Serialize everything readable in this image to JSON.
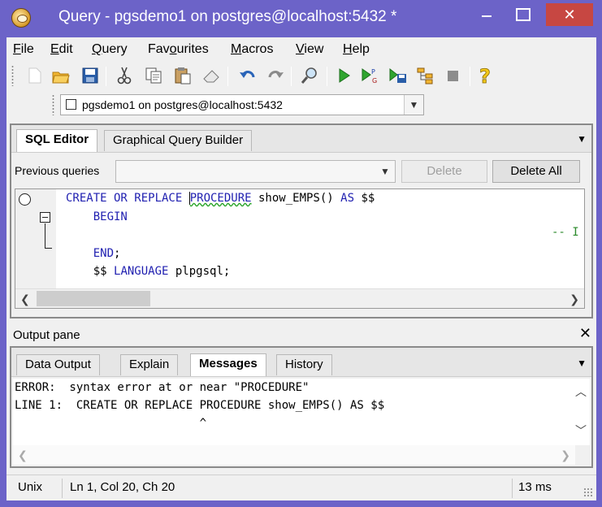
{
  "window": {
    "title": "Query - pgsdemo1 on postgres@localhost:5432 *",
    "minimize_glyph": "",
    "maximize_glyph": "",
    "close_glyph": "✕"
  },
  "menu": [
    {
      "label": "File",
      "mnemonic": "F",
      "rest": "ile"
    },
    {
      "label": "Edit",
      "mnemonic": "E",
      "rest": "dit"
    },
    {
      "label": "Query",
      "mnemonic": "Q",
      "rest": "uery"
    },
    {
      "label": "Favourites",
      "pre": "Fav",
      "mnemonic": "o",
      "rest": "urites"
    },
    {
      "label": "Macros",
      "mnemonic": "M",
      "rest": "acros"
    },
    {
      "label": "View",
      "mnemonic": "V",
      "rest": "iew"
    },
    {
      "label": "Help",
      "mnemonic": "H",
      "rest": "elp"
    }
  ],
  "toolbar": {
    "icons": [
      "new-file-icon",
      "open-folder-icon",
      "save-icon",
      "cut-icon",
      "copy-icon",
      "paste-icon",
      "clear-icon",
      "undo-icon",
      "redo-icon",
      "find-icon",
      "execute-icon",
      "execute-pgscript-icon",
      "execute-to-file-icon",
      "explain-icon",
      "cancel-query-icon",
      "help-icon"
    ]
  },
  "connection": {
    "value": "pgsdemo1 on postgres@localhost:5432"
  },
  "sql_panel": {
    "tabs": [
      "SQL Editor",
      "Graphical Query Builder"
    ],
    "active_tab": "SQL Editor",
    "previous_queries_label": "Previous queries",
    "delete_label": "Delete",
    "delete_all_label": "Delete All",
    "code_lines": [
      "CREATE OR REPLACE PROCEDURE show_EMPS() AS $$",
      "    BEGIN",
      "",
      "    END;",
      "    $$ LANGUAGE plpgsql;"
    ],
    "comment_fragment": "-- I"
  },
  "output": {
    "title": "Output pane",
    "close_glyph": "✕",
    "tabs": [
      "Data Output",
      "Explain",
      "Messages",
      "History"
    ],
    "active_tab": "Messages",
    "messages": [
      "ERROR:  syntax error at or near \"PROCEDURE\"",
      "LINE 1:  CREATE OR REPLACE PROCEDURE show_EMPS() AS $$",
      "                           ^"
    ]
  },
  "status": {
    "line_endings": "Unix",
    "position": "Ln 1, Col 20, Ch 20",
    "elapsed": "13 ms"
  },
  "colors": {
    "window_frame": "#6c63c8",
    "close_button": "#c74742",
    "keyword": "#1f1fb0",
    "comment": "#2a8a2a"
  }
}
